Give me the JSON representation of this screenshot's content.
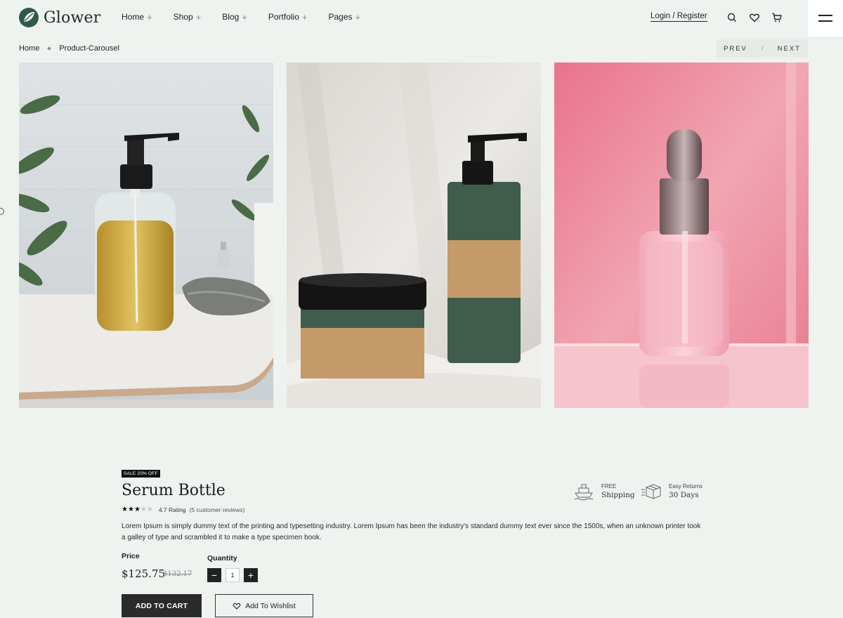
{
  "header": {
    "brand": "Glower",
    "nav": [
      {
        "label": "Home"
      },
      {
        "label": "Shop"
      },
      {
        "label": "Blog"
      },
      {
        "label": "Portfolio"
      },
      {
        "label": "Pages"
      }
    ],
    "nav_plus": "+",
    "login_label": "Login / Register",
    "icons": [
      "search-icon",
      "heart-icon",
      "cart-icon",
      "menu-icon"
    ]
  },
  "breadcrumb": {
    "home": "Home",
    "current": "Product-Carousel"
  },
  "carousel": {
    "prev": "PREV",
    "slash": "/",
    "next": "NEXT",
    "images": [
      "pump-bottle-oil",
      "green-bottle-and-jar",
      "pink-serum-dropper"
    ]
  },
  "product": {
    "badge": "SALE 20% OFF",
    "title": "Serum Bottle",
    "rating_value": 3,
    "rating_max": 5,
    "rating_text": "4.7 Rating",
    "reviews_text": "(5 customer reviews)",
    "description": "Lorem Ipsum is simply dummy text of the printing and typesetting industry. Lorem Ipsum has been the industry's standard dummy text ever since the 1500s, when an unknown printer took a galley of type and scrambled it to make a type specimen book.",
    "price_label": "Price",
    "price": "$125.75",
    "old_price": "$132.17",
    "quantity_label": "Quantity",
    "quantity": "1",
    "minus": "−",
    "plus": "+",
    "add_to_cart": "ADD TO CART",
    "add_to_wishlist": "Add To Wishlist"
  },
  "features": [
    {
      "small": "FREE",
      "big": "Shipping",
      "icon": "ship-icon"
    },
    {
      "small": "Easy Returns",
      "big": "30 Days",
      "icon": "box-icon"
    }
  ],
  "colors": {
    "background": "#eef3f0",
    "brand_green": "#2f5a4a",
    "dark": "#2b2b2b"
  }
}
